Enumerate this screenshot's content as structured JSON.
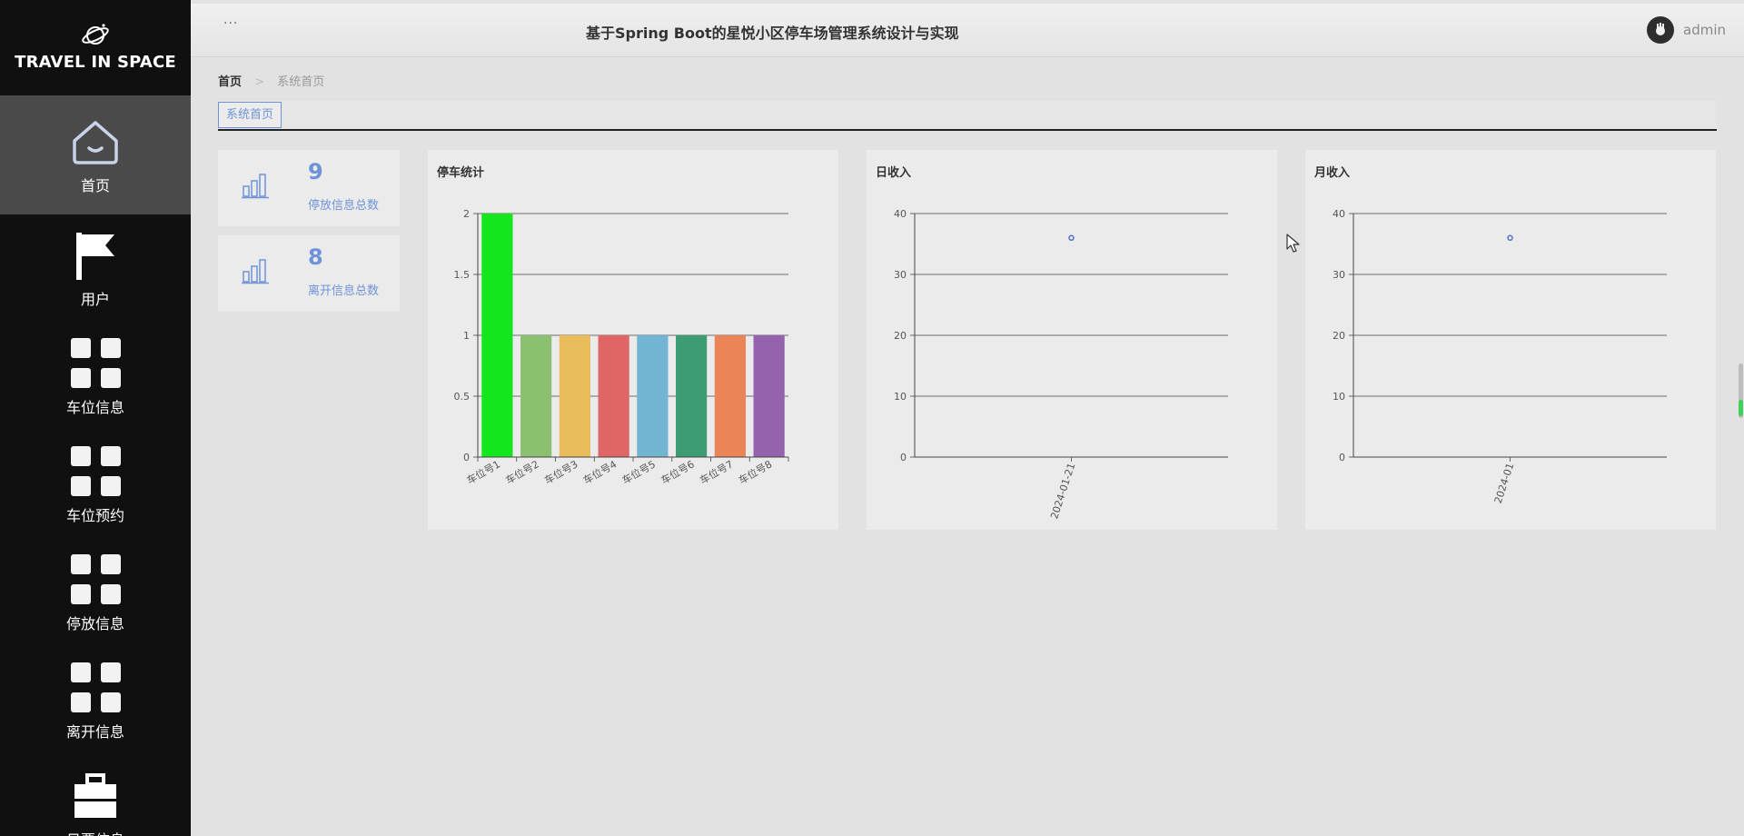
{
  "brand": {
    "text": "TRAVEL IN SPACE",
    "icon": "planet-icon"
  },
  "sidebar": {
    "items": [
      {
        "label": "首页",
        "icon": "home-icon",
        "active": true
      },
      {
        "label": "用户",
        "icon": "flag-icon"
      },
      {
        "label": "车位信息",
        "icon": "grid-icon"
      },
      {
        "label": "车位预约",
        "icon": "grid-icon"
      },
      {
        "label": "停放信息",
        "icon": "grid-icon"
      },
      {
        "label": "离开信息",
        "icon": "grid-icon"
      },
      {
        "label": "日票信息",
        "icon": "briefcase-icon"
      }
    ]
  },
  "header": {
    "menu_toggle": "···",
    "title": "基于Spring Boot的星悦小区停车场管理系统设计与实现",
    "user": {
      "name": "admin",
      "icon": "avatar-icon"
    }
  },
  "breadcrumb": {
    "home": "首页",
    "separator": ">",
    "current": "系统首页"
  },
  "tabs": [
    {
      "label": "系统首页",
      "active": true
    }
  ],
  "stats": [
    {
      "value": "9",
      "label": "停放信息总数",
      "icon": "bar-chart-icon"
    },
    {
      "value": "8",
      "label": "离开信息总数",
      "icon": "bar-chart-icon"
    }
  ],
  "colors": {
    "accent": "#6f93d8",
    "sidebar_bg": "#101010",
    "active_nav": "#4a4a4a"
  },
  "chart_data": [
    {
      "type": "bar",
      "title": "停车统计",
      "categories": [
        "车位号1",
        "车位号2",
        "车位号3",
        "车位号4",
        "车位号5",
        "车位号6",
        "车位号7",
        "车位号8"
      ],
      "values": [
        2,
        1,
        1,
        1,
        1,
        1,
        1,
        1
      ],
      "colors": [
        "#13e61c",
        "#8cc071",
        "#e8bc5a",
        "#df6566",
        "#72b5d3",
        "#3e9c74",
        "#eb8557",
        "#9563ae"
      ],
      "yticks": [
        "0",
        "0.5",
        "1",
        "1.5",
        "2"
      ],
      "ylim": [
        0,
        2
      ],
      "grid": true
    },
    {
      "type": "scatter",
      "title": "日收入",
      "x": [
        "2024-01-21"
      ],
      "y": [
        36
      ],
      "yticks": [
        "0",
        "10",
        "20",
        "30",
        "40"
      ],
      "ylim": [
        0,
        40
      ],
      "grid": true
    },
    {
      "type": "scatter",
      "title": "月收入",
      "x": [
        "2024-01"
      ],
      "y": [
        36
      ],
      "yticks": [
        "0",
        "10",
        "20",
        "30",
        "40"
      ],
      "ylim": [
        0,
        40
      ],
      "grid": true
    }
  ]
}
